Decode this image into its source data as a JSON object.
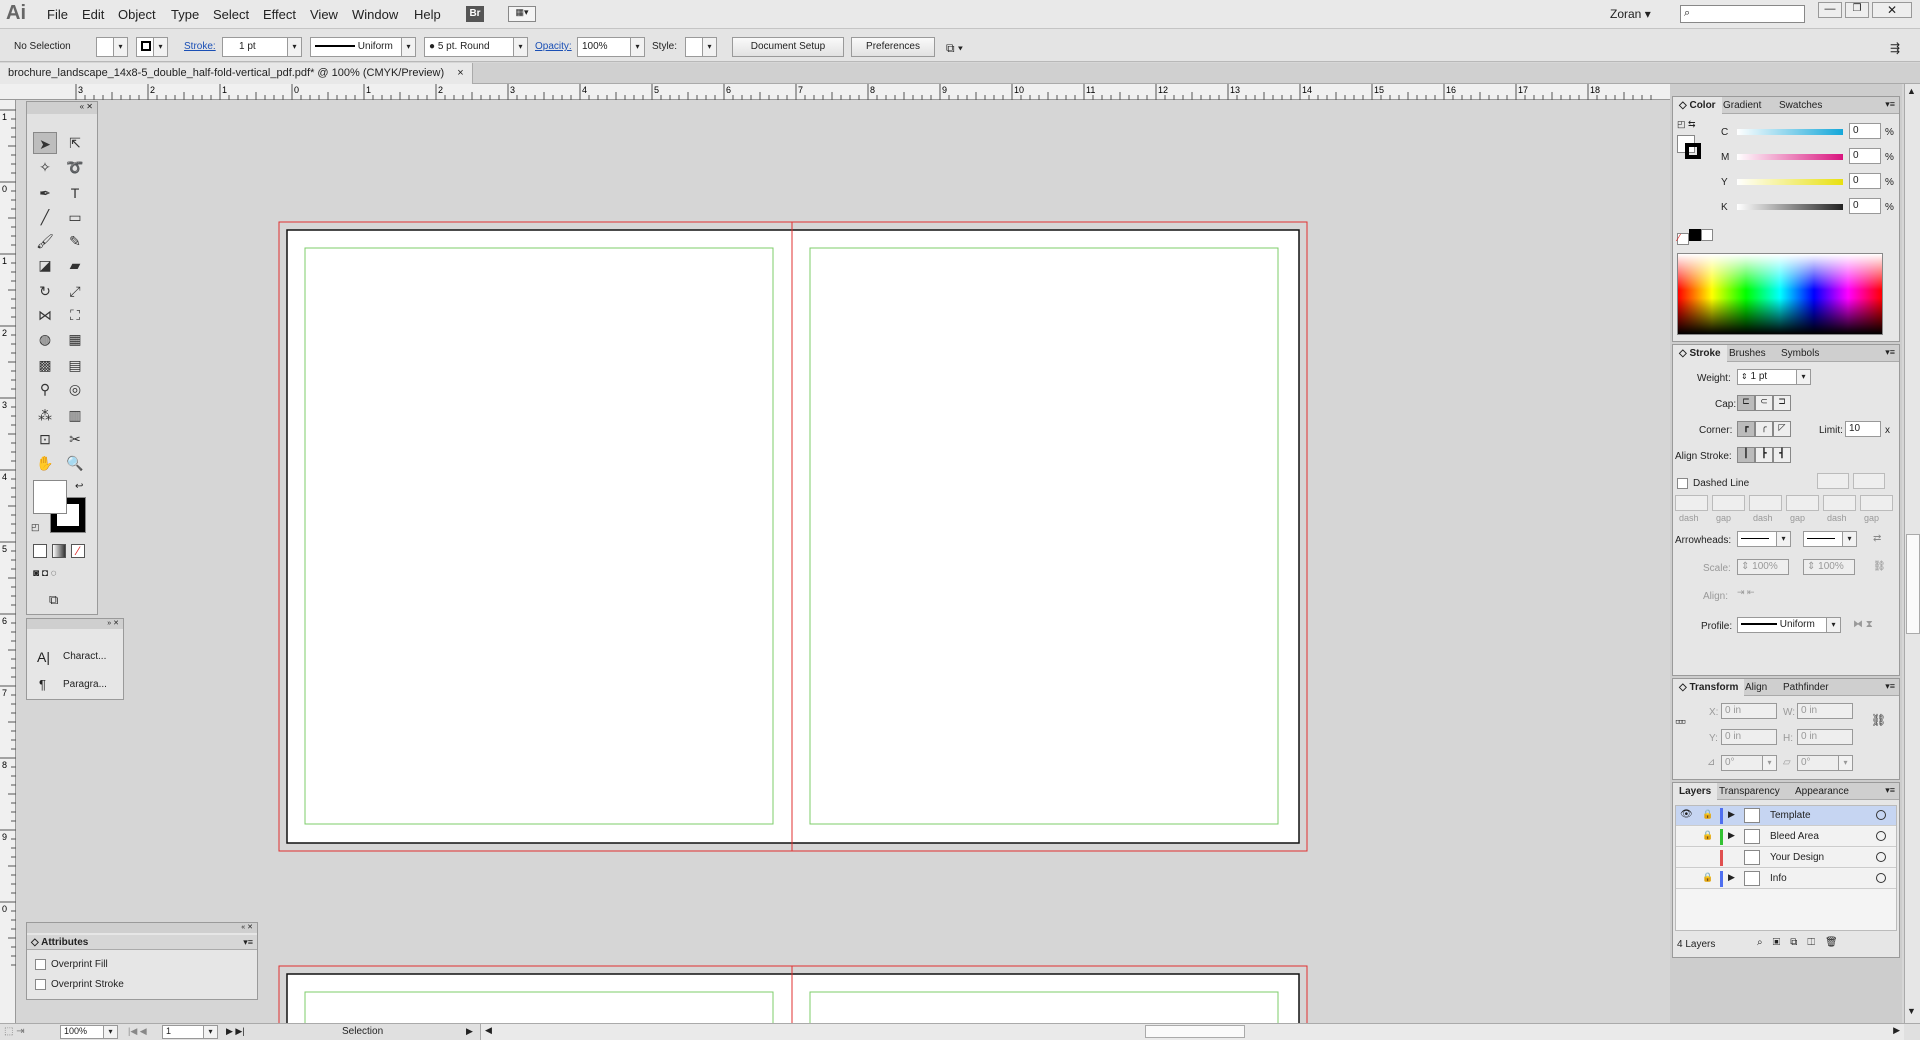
{
  "app": {
    "logo": "Ai"
  },
  "menu": [
    "File",
    "Edit",
    "Object",
    "Type",
    "Select",
    "Effect",
    "View",
    "Window",
    "Help"
  ],
  "bridge_label": "Br",
  "user": "Zoran",
  "control": {
    "selection": "No Selection",
    "stroke_label": "Stroke:",
    "stroke_weight": "1 pt",
    "profile": "Uniform",
    "brush": "5 pt. Round",
    "opacity_label": "Opacity:",
    "opacity": "100%",
    "style_label": "Style:",
    "doc_setup": "Document Setup",
    "preferences": "Preferences"
  },
  "document_tab": "brochure_landscape_14x8-5_double_half-fold-vertical_pdf.pdf* @ 100% (CMYK/Preview)",
  "ruler_h": [
    "3",
    "2",
    "1",
    "0",
    "1",
    "2",
    "3",
    "4",
    "5",
    "6",
    "7",
    "8",
    "9",
    "10",
    "11",
    "12",
    "13",
    "14",
    "15",
    "16",
    "17",
    "18"
  ],
  "ruler_v": [
    "1",
    "0",
    "1",
    "2",
    "3",
    "4",
    "5",
    "6",
    "7",
    "8",
    "9",
    "0"
  ],
  "char_panel": {
    "character": "Charact...",
    "paragraph": "Paragra..."
  },
  "attributes": {
    "title": "Attributes",
    "overprint_fill": "Overprint Fill",
    "overprint_stroke": "Overprint Stroke"
  },
  "color_panel": {
    "tabs": [
      "Color",
      "Gradient",
      "Swatches"
    ],
    "channels": [
      {
        "label": "C",
        "value": "0",
        "pct": "%",
        "color": "#14a7d9"
      },
      {
        "label": "M",
        "value": "0",
        "pct": "%",
        "color": "#d9147e"
      },
      {
        "label": "Y",
        "value": "0",
        "pct": "%",
        "color": "#e8e00f"
      },
      {
        "label": "K",
        "value": "0",
        "pct": "%",
        "color": "#222222"
      }
    ]
  },
  "stroke_panel": {
    "tabs": [
      "Stroke",
      "Brushes",
      "Symbols"
    ],
    "weight_label": "Weight:",
    "weight": "1 pt",
    "cap_label": "Cap:",
    "corner_label": "Corner:",
    "limit_label": "Limit:",
    "limit": "10",
    "limit_x": "x",
    "align_label": "Align Stroke:",
    "dashed": "Dashed Line",
    "dash_labels": [
      "dash",
      "gap",
      "dash",
      "gap",
      "dash",
      "gap"
    ],
    "arrowheads_label": "Arrowheads:",
    "scale_label": "Scale:",
    "scale1": "100%",
    "scale2": "100%",
    "align2_label": "Align:",
    "profile_label": "Profile:",
    "profile": "Uniform"
  },
  "transform_panel": {
    "tabs": [
      "Transform",
      "Align",
      "Pathfinder"
    ],
    "x_label": "X:",
    "x": "0 in",
    "w_label": "W:",
    "w": "0 in",
    "y_label": "Y:",
    "y": "0 in",
    "h_label": "H:",
    "h": "0 in",
    "angle": "0°",
    "shear": "0°"
  },
  "layers_panel": {
    "tabs": [
      "Layers",
      "Transparency",
      "Appearance"
    ],
    "layers": [
      {
        "name": "Template",
        "color": "#4f6ff0"
      },
      {
        "name": "Bleed Area",
        "color": "#33c233"
      },
      {
        "name": "Your Design",
        "color": "#e05050"
      },
      {
        "name": "Info",
        "color": "#4f6ff0"
      }
    ],
    "count": "4 Layers"
  },
  "status": {
    "zoom": "100%",
    "page": "1",
    "tool": "Selection"
  }
}
